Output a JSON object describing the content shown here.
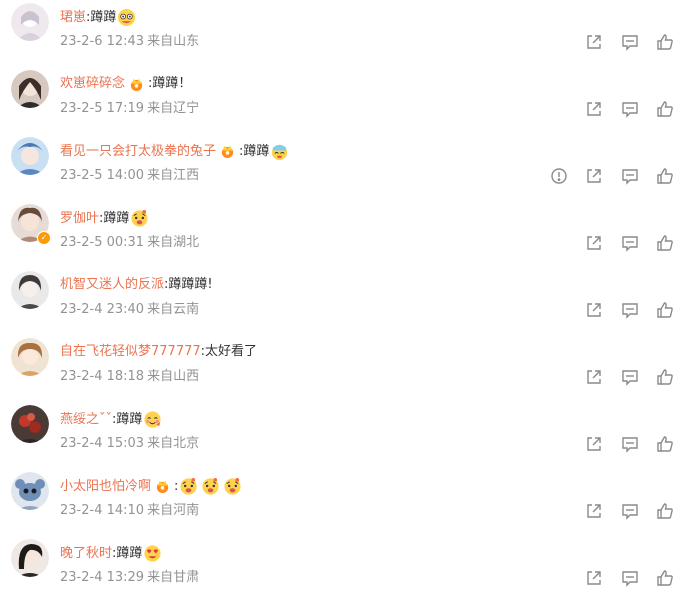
{
  "colors": {
    "name": "#eb7350",
    "text": "#333333",
    "meta": "#939393",
    "icon": "#8a8a8a",
    "badge": "#ff9a00"
  },
  "icons": {
    "share": "share-icon",
    "comment": "comment-icon",
    "like": "like-icon",
    "report": "report-icon"
  },
  "comments": [
    {
      "name": "珺崽",
      "text": ":蹲蹲",
      "date": "23-2-6 12:43",
      "from": "来自山东",
      "emojis": 1
    },
    {
      "name": "欢崽碎碎念",
      "text": ":蹲蹲！",
      "date": "23-2-5 17:19",
      "from": "来自辽宁",
      "crown": true
    },
    {
      "name": "看见一只会打太极拳的兔子",
      "text": ":蹲蹲",
      "date": "23-2-5 14:00",
      "from": "来自江西",
      "crown": true,
      "emojis": 1,
      "report": true
    },
    {
      "name": "罗伽叶",
      "text": ":蹲蹲",
      "date": "23-2-5 00:31",
      "from": "来自湖北",
      "emojis": 1,
      "verified": true
    },
    {
      "name": "机智又迷人的反派",
      "text": ":蹲蹲蹲!",
      "date": "23-2-4 23:40",
      "from": "来自云南"
    },
    {
      "name": "自在飞花轻似梦777777",
      "text": ":太好看了",
      "date": "23-2-4 18:18",
      "from": "来自山西"
    },
    {
      "name": "燕绥之ˇˇ",
      "text": ":蹲蹲",
      "date": "23-2-4 15:03",
      "from": "来自北京",
      "emojis": 1
    },
    {
      "name": "小太阳也怕冷啊",
      "text": ":",
      "date": "23-2-4 14:10",
      "from": "来自河南",
      "crown": true,
      "emojis": 3
    },
    {
      "name": "晚了秋时",
      "text": ":蹲蹲",
      "date": "23-2-4 13:29",
      "from": "来自甘肃",
      "emojis": 1
    }
  ]
}
